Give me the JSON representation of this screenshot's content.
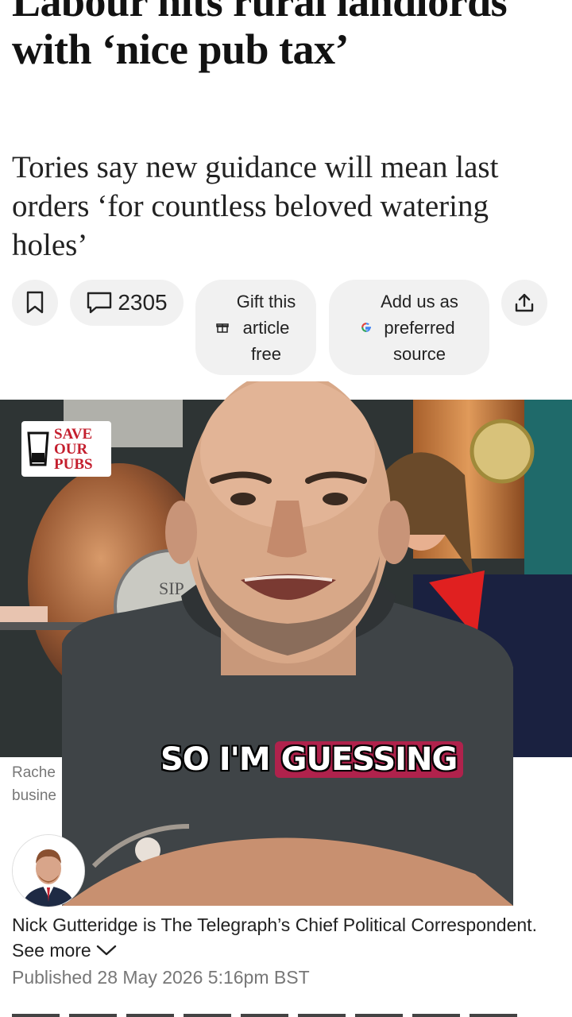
{
  "article": {
    "headline": "Labour hits rural landlords with ‘nice pub tax’",
    "standfirst": "Tories say new guidance will mean last orders ‘for countless beloved watering holes’"
  },
  "actions": {
    "comment_count": "2305",
    "gift_lines": [
      "Gift this",
      "article",
      "free"
    ],
    "source_lines": [
      "Add us as",
      "preferred",
      "source"
    ]
  },
  "image": {
    "badge_lines": [
      "SAVE",
      "OUR",
      "PUBS"
    ],
    "plaque_text": "SIP",
    "caption_line1": "Rache",
    "caption_line2": "busine"
  },
  "video_overlay": {
    "subtitle_plain": "SO I'M",
    "subtitle_highlight": "GUESSING",
    "highlight_color": "#b0224c"
  },
  "author": {
    "bio": "Nick Gutteridge is The Telegraph’s Chief Political Correspondent.",
    "see_more": "See more",
    "published": "Published 28 May 2026 5:16pm BST"
  },
  "icons": [
    "bookmark-icon",
    "comment-icon",
    "gift-icon",
    "google-icon",
    "share-icon",
    "chevron-down-icon"
  ]
}
